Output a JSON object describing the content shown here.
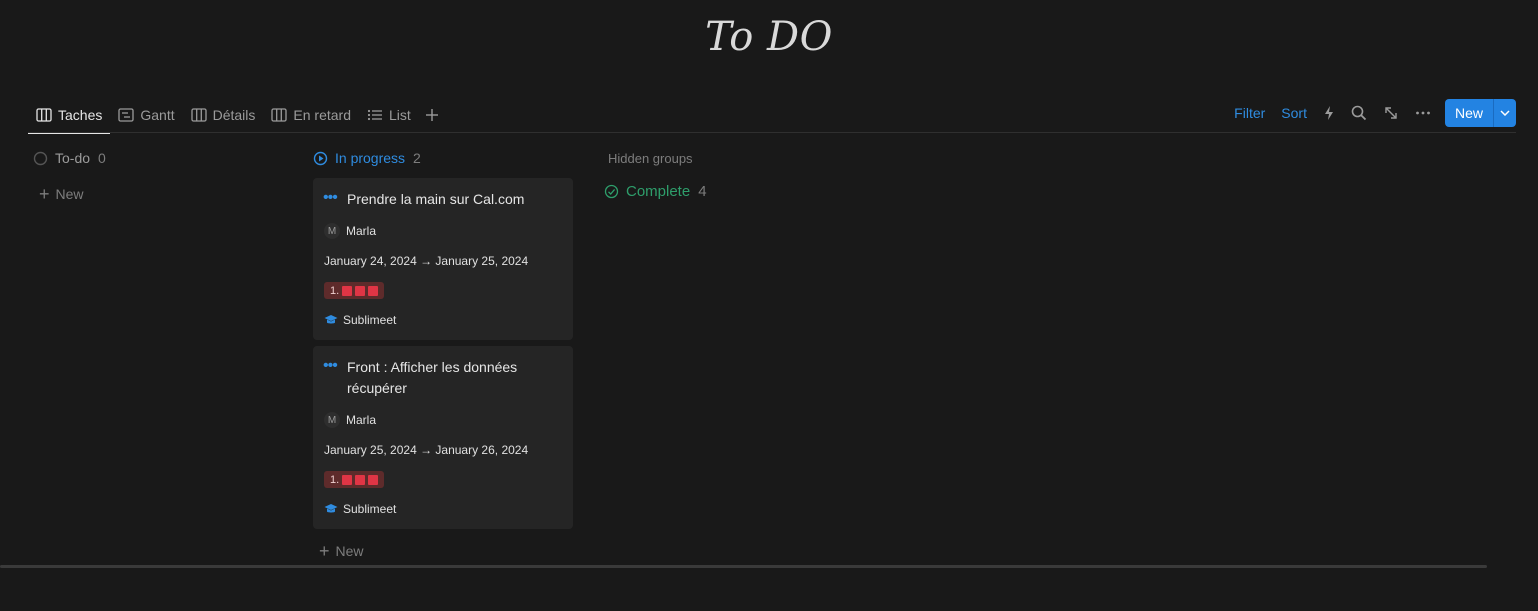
{
  "page": {
    "title": "To DO"
  },
  "tabs": [
    {
      "label": "Taches",
      "icon": "board-icon",
      "active": true
    },
    {
      "label": "Gantt",
      "icon": "timeline-icon",
      "active": false
    },
    {
      "label": "Détails",
      "icon": "board-icon",
      "active": false
    },
    {
      "label": "En retard",
      "icon": "board-icon",
      "active": false
    },
    {
      "label": "List",
      "icon": "list-icon",
      "active": false
    }
  ],
  "toolbar": {
    "filter": "Filter",
    "sort": "Sort",
    "new": "New"
  },
  "colors": {
    "accent": "#2383e2",
    "link": "#2f8ce0",
    "in_progress": "#2f8ce0",
    "complete": "#2e9e6b",
    "priority": "#e03545"
  },
  "columns": {
    "todo": {
      "label": "To-do",
      "count": "0",
      "add": "New"
    },
    "in_progress": {
      "label": "In progress",
      "count": "2",
      "add": "New",
      "cards": [
        {
          "title": "Prendre la main sur Cal.com",
          "assignee_initial": "M",
          "assignee": "Marla",
          "dates": "January 24, 2024 → January 25, 2024",
          "priority": "1.",
          "project": "Sublimeet"
        },
        {
          "title": "Front : Afficher les données récupérer",
          "assignee_initial": "M",
          "assignee": "Marla",
          "dates": "January 25, 2024 → January 26, 2024",
          "priority": "1.",
          "project": "Sublimeet"
        }
      ]
    },
    "hidden": {
      "label": "Hidden groups",
      "group": "Complete",
      "count": "4"
    }
  }
}
